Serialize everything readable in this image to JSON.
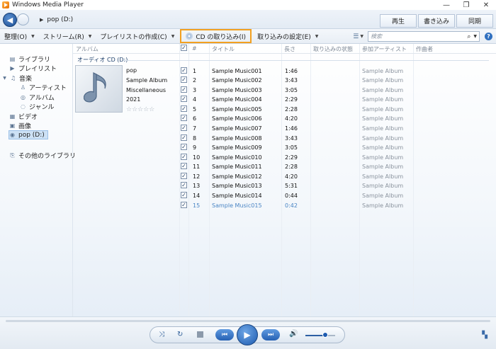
{
  "window": {
    "title": "Windows Media Player",
    "controls": [
      "—",
      "❐",
      "✕"
    ]
  },
  "nav": {
    "breadcrumb": "pop (D:)"
  },
  "tabs": [
    "再生",
    "書き込み",
    "同期"
  ],
  "toolbar": {
    "organize": "整理(O)",
    "stream": "ストリーム(R)",
    "create_playlist": "プレイリストの作成(C)",
    "rip_cd": "CD の取り込み(I)",
    "rip_settings": "取り込みの設定(E)",
    "search_placeholder": "検索"
  },
  "sidebar": {
    "library": "ライブラリ",
    "playlists": "プレイリスト",
    "music": "音楽",
    "artist": "アーティスト",
    "album": "アルバム",
    "genre": "ジャンル",
    "video": "ビデオ",
    "pictures": "画像",
    "drive": "pop (D:)",
    "other_libraries": "その他のライブラリ"
  },
  "columns": {
    "album": "アルバム",
    "number": "#",
    "title": "タイトル",
    "length": "長さ",
    "rip_status": "取り込みの状態",
    "contributing_artist": "参加アーティスト",
    "composer": "作曲者"
  },
  "group_label": "オーディオ CD (D:)",
  "album_info": {
    "artist": "pop",
    "album": "Sample Album",
    "genre": "Miscellaneous",
    "year": "2021",
    "rating": "☆☆☆☆☆"
  },
  "tracks": [
    {
      "checked": "✓",
      "number": "1",
      "title": "Sample Music001",
      "length": "1:46",
      "artist": "Sample Album"
    },
    {
      "checked": "✓",
      "number": "2",
      "title": "Sample Music002",
      "length": "3:43",
      "artist": "Sample Album"
    },
    {
      "checked": "✓",
      "number": "3",
      "title": "Sample Music003",
      "length": "3:05",
      "artist": "Sample Album"
    },
    {
      "checked": "✓",
      "number": "4",
      "title": "Sample Music004",
      "length": "2:29",
      "artist": "Sample Album"
    },
    {
      "checked": "✓",
      "number": "5",
      "title": "Sample Music005",
      "length": "2:28",
      "artist": "Sample Album"
    },
    {
      "checked": "✓",
      "number": "6",
      "title": "Sample Music006",
      "length": "4:20",
      "artist": "Sample Album"
    },
    {
      "checked": "✓",
      "number": "7",
      "title": "Sample Music007",
      "length": "1:46",
      "artist": "Sample Album"
    },
    {
      "checked": "✓",
      "number": "8",
      "title": "Sample Music008",
      "length": "3:43",
      "artist": "Sample Album"
    },
    {
      "checked": "✓",
      "number": "9",
      "title": "Sample Music009",
      "length": "3:05",
      "artist": "Sample Album"
    },
    {
      "checked": "✓",
      "number": "10",
      "title": "Sample Music010",
      "length": "2:29",
      "artist": "Sample Album"
    },
    {
      "checked": "✓",
      "number": "11",
      "title": "Sample Music011",
      "length": "2:28",
      "artist": "Sample Album"
    },
    {
      "checked": "✓",
      "number": "12",
      "title": "Sample Music012",
      "length": "4:20",
      "artist": "Sample Album"
    },
    {
      "checked": "✓",
      "number": "13",
      "title": "Sample Music013",
      "length": "5:31",
      "artist": "Sample Album"
    },
    {
      "checked": "✓",
      "number": "14",
      "title": "Sample Music014",
      "length": "0:44",
      "artist": "Sample Album"
    },
    {
      "checked": "✓",
      "number": "15",
      "title": "Sample Music015",
      "length": "0:42",
      "artist": "Sample Album",
      "playing": true
    }
  ],
  "player": {
    "volume": 0.6,
    "progress": 0
  },
  "icons": {
    "back": "back-arrow-icon",
    "forward": "forward-arrow-icon",
    "shuffle": "shuffle-icon",
    "repeat": "repeat-icon",
    "stop": "stop-icon",
    "previous": "previous-icon",
    "play": "play-icon",
    "next": "next-icon",
    "volume": "speaker-icon",
    "switch_view": "switch-view-icon"
  },
  "colors": {
    "rip_highlight": "#f2a020",
    "accent": "#1d5bb0",
    "playing_text": "#4a85c4"
  }
}
